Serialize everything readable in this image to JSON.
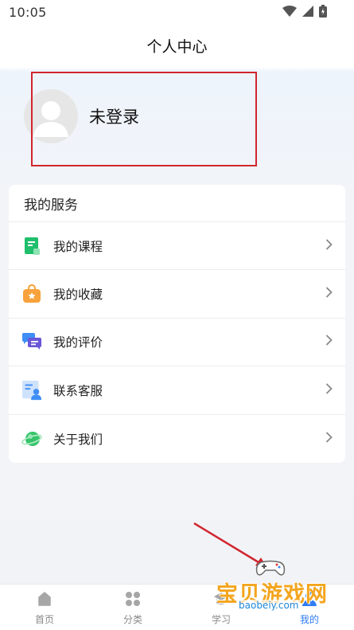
{
  "status_bar": {
    "time": "10:05"
  },
  "header": {
    "title": "个人中心"
  },
  "profile": {
    "login_status": "未登录"
  },
  "services": {
    "title": "我的服务",
    "items": [
      {
        "label": "我的课程",
        "icon": "course-book-icon",
        "color": "#1fbf6c"
      },
      {
        "label": "我的收藏",
        "icon": "favorites-bag-icon",
        "color": "#f7a23d"
      },
      {
        "label": "我的评价",
        "icon": "review-chat-icon",
        "color": "#6a56d8"
      },
      {
        "label": "联系客服",
        "icon": "customer-service-icon",
        "color": "#3e8ef5"
      },
      {
        "label": "关于我们",
        "icon": "about-planet-icon",
        "color": "#35c46a"
      }
    ]
  },
  "tabs": [
    {
      "label": "首页",
      "icon": "home-icon",
      "active": false
    },
    {
      "label": "分类",
      "icon": "category-icon",
      "active": false
    },
    {
      "label": "学习",
      "icon": "study-icon",
      "active": false
    },
    {
      "label": "我的",
      "icon": "mine-icon",
      "active": true
    }
  ],
  "watermark": {
    "text": "宝贝游戏网",
    "url": "baobeiy.com"
  },
  "colors": {
    "accent": "#2f7cf6",
    "annotation": "#d0262e",
    "tab_inactive": "#8a8a8a"
  }
}
